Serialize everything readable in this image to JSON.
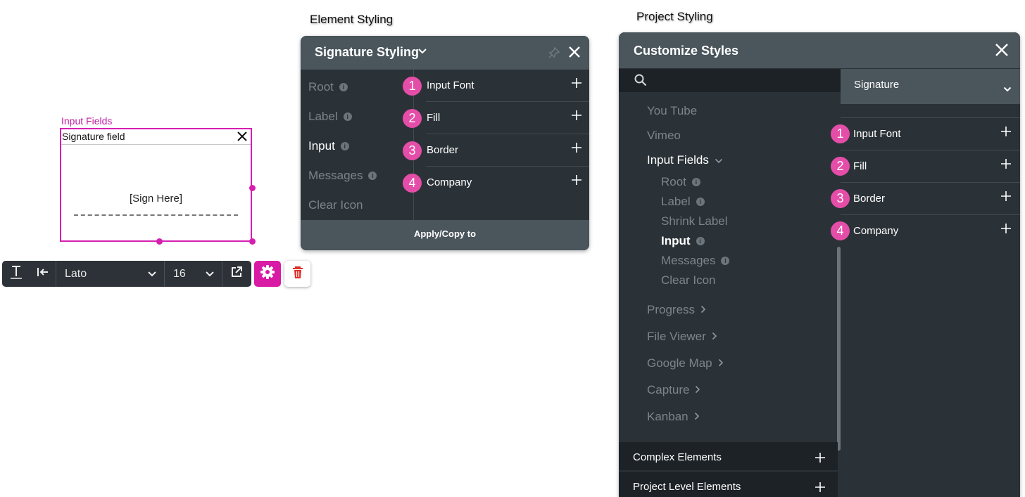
{
  "captions": {
    "element_styling": "Element Styling",
    "project_styling": "Project Styling"
  },
  "widget": {
    "tag": "Input Fields",
    "field_label": "Signature field",
    "placeholder": "[Sign Here]",
    "colors": {
      "accent": "#d61fb0"
    }
  },
  "toolbar": {
    "font": "Lato",
    "size": "16"
  },
  "element_styling": {
    "title": "Signature Styling",
    "nav": [
      {
        "label": "Root",
        "info": "i"
      },
      {
        "label": "Label",
        "info": "i"
      },
      {
        "label": "Input",
        "info": "i"
      },
      {
        "label": "Messages",
        "info": "i"
      },
      {
        "label": "Clear Icon"
      }
    ],
    "active_nav": "Input",
    "properties": [
      {
        "num": "1",
        "label": "Input Font"
      },
      {
        "num": "2",
        "label": "Fill"
      },
      {
        "num": "3",
        "label": "Border"
      },
      {
        "num": "4",
        "label": "Company"
      }
    ],
    "footer": "Apply/Copy to"
  },
  "project_styling": {
    "title": "Customize Styles",
    "selected_element": "Signature",
    "tree": {
      "youtube": "You Tube",
      "vimeo": "Vimeo",
      "input_fields": "Input Fields",
      "children": {
        "root": "Root",
        "label": "Label",
        "shrink_label": "Shrink Label",
        "input": "Input",
        "messages": "Messages",
        "clear_icon": "Clear Icon"
      },
      "progress": "Progress",
      "file_viewer": "File Viewer",
      "google_map": "Google Map",
      "capture": "Capture",
      "kanban": "Kanban"
    },
    "sections": {
      "complex": "Complex Elements",
      "project_level": "Project Level Elements"
    },
    "properties": [
      {
        "num": "1",
        "label": "Input Font"
      },
      {
        "num": "2",
        "label": "Fill"
      },
      {
        "num": "3",
        "label": "Border"
      },
      {
        "num": "4",
        "label": "Company"
      }
    ]
  }
}
